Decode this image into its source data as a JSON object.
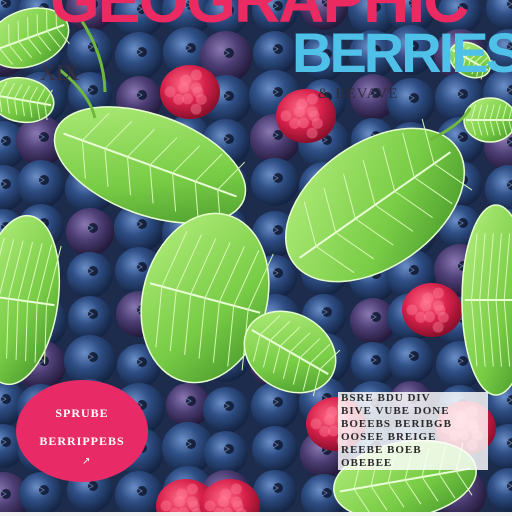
{
  "cover": {
    "masthead": "GEOGRAPHIC",
    "subtitle": "BERRIES",
    "tagline": "& BEVAVE",
    "corner_mark": "XIX",
    "badge": {
      "line1": "SPRUBE",
      "line2": "BERRIPPEBS",
      "mark": "↗"
    },
    "caption": [
      "BSRE BDU DIV",
      "BIVE VUBE DONE",
      "BOEEBS BERIBGB",
      "OOSEE BREIGE",
      "REEBE BOEB",
      "OBEBEE"
    ]
  },
  "colors": {
    "masthead": "#ec2a62",
    "subtitle": "#4fc1e9",
    "badge": "#e82a66",
    "background": "#f4f4f2",
    "leaf": "#7fd14e",
    "blueberry": "#26406e",
    "raspberry": "#d81f4a"
  },
  "icons": {
    "badge_mark": "arrow-icon"
  }
}
